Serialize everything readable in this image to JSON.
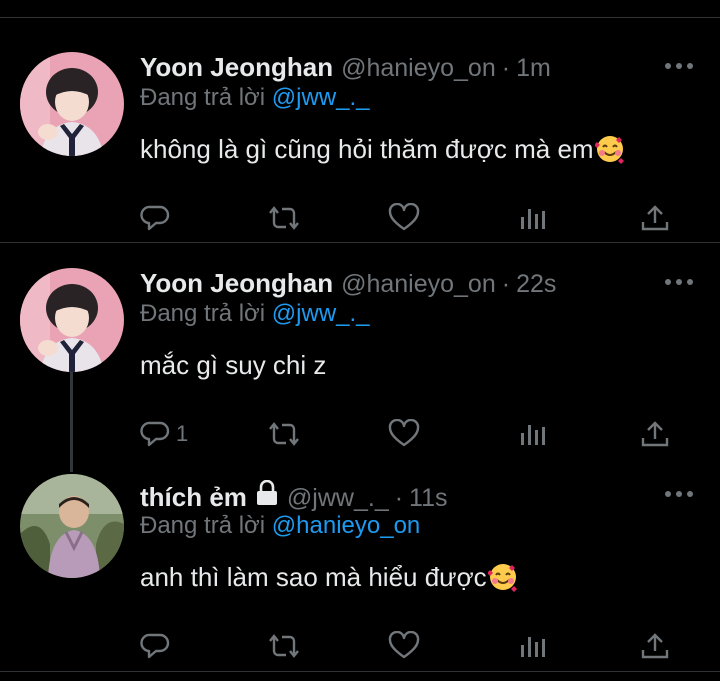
{
  "tweets": [
    {
      "name": "Yoon Jeonghan",
      "handle": "@hanieyo_on",
      "separator": "·",
      "time": "1m",
      "reply_prefix": "Đang trả lời",
      "reply_to": "@jww_._",
      "text": "không là gì cũng hỏi thăm được mà em",
      "emoji": "smiling-face-with-hearts",
      "reply_count": "",
      "avatar": "profile-photo-pink"
    },
    {
      "name": "Yoon Jeonghan",
      "handle": "@hanieyo_on",
      "separator": "·",
      "time": "22s",
      "reply_prefix": "Đang trả lời",
      "reply_to": "@jww_._",
      "text": "mắc gì suy chi z",
      "emoji": "",
      "reply_count": "1",
      "avatar": "profile-photo-pink"
    },
    {
      "name": "thích ẻm",
      "handle": "@jww_._",
      "separator": "·",
      "time": "11s",
      "reply_prefix": "Đang trả lời",
      "reply_to": "@hanieyo_on",
      "text": "anh thì làm sao mà hiểu được",
      "emoji": "smiling-face-with-hearts",
      "reply_count": "",
      "protected": true,
      "avatar": "profile-photo-child"
    }
  ],
  "icons": {
    "more": "more-icon",
    "reply": "reply-icon",
    "retweet": "retweet-icon",
    "like": "like-icon",
    "views": "views-icon",
    "share": "share-icon",
    "lock": "lock-icon"
  },
  "colors": {
    "background": "#000000",
    "primary_text": "#e7e9ea",
    "secondary_text": "#71767b",
    "mention": "#1d9bf0",
    "divider": "#2f3336"
  }
}
